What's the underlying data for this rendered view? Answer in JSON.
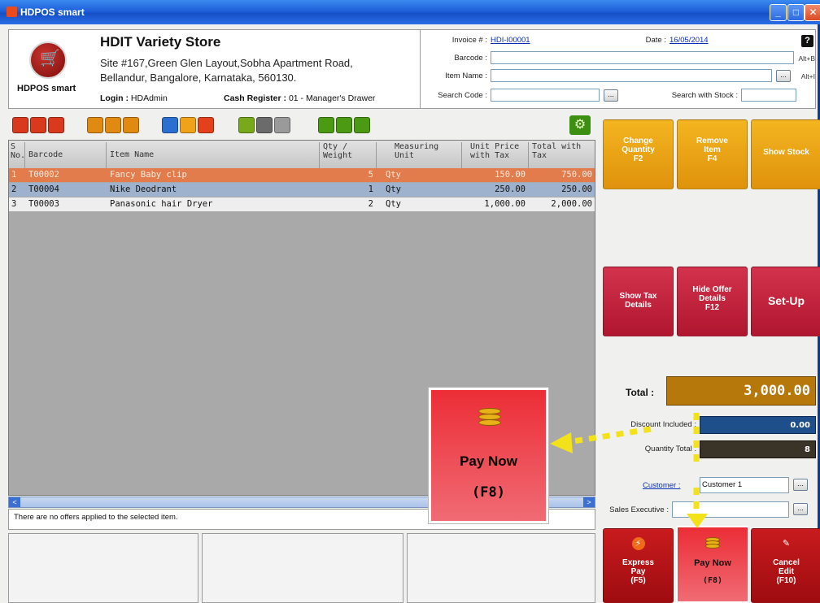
{
  "window": {
    "title": "HDPOS smart",
    "controls": {
      "minimize": "_",
      "maximize": "□",
      "close": "✕"
    }
  },
  "store": {
    "logo_text": "HDPOS smart",
    "name": "HDIT Variety Store",
    "address_line1": "Site #167,Green Glen Layout,Sobha Apartment Road,",
    "address_line2": "Bellandur, Bangalore, Karnataka, 560130.",
    "login_label": "Login :",
    "login_value": "HDAdmin",
    "register_label": "Cash Register :",
    "register_value": "01 - Manager's Drawer"
  },
  "invoice": {
    "number_label": "Invoice # :",
    "number_value": "HDI-I00001",
    "date_label": "Date :",
    "date_value": "16/05/2014",
    "help": "?",
    "barcode_label": "Barcode :",
    "barcode_hint": "Alt+B",
    "item_name_label": "Item Name :",
    "item_name_hint": "Alt+I",
    "search_code_label": "Search Code :",
    "search_stock_label": "Search with Stock :",
    "ellipsis": "..."
  },
  "toolbar": {
    "icons": [
      {
        "name": "report-icon",
        "color": "#d93a1e"
      },
      {
        "name": "open-icon",
        "color": "#d93a1e"
      },
      {
        "name": "list-icon",
        "color": "#d93a1e"
      },
      {
        "name": "edit-icon",
        "color": "#e08a12"
      },
      {
        "name": "cart-icon",
        "color": "#e08a12"
      },
      {
        "name": "user-icon",
        "color": "#e08a12"
      },
      {
        "name": "hold-icon",
        "color": "#2b6fd0"
      },
      {
        "name": "note-icon",
        "color": "#f0a21a"
      },
      {
        "name": "return-icon",
        "color": "#e2411b"
      },
      {
        "name": "calc-icon",
        "color": "#77a91a"
      },
      {
        "name": "coin-icon",
        "color": "#6b6b6b"
      },
      {
        "name": "delete-icon",
        "color": "#9a9a9a"
      },
      {
        "name": "calculator-icon",
        "color": "#4c9a14"
      },
      {
        "name": "grid-icon",
        "color": "#4c9a14"
      },
      {
        "name": "clipboard-icon",
        "color": "#4c9a14"
      }
    ],
    "settings_icon": "⚙"
  },
  "grid": {
    "columns": [
      "S No.",
      "Barcode",
      "Item Name",
      "Qty / Weight",
      "Measuring Unit",
      "Unit Price with Tax",
      "Total with Tax"
    ],
    "rows": [
      {
        "sno": "1",
        "barcode": "T00002",
        "name": "Fancy Baby clip",
        "qty": "5",
        "unit": "Qty",
        "price": "150.00",
        "total": "750.00"
      },
      {
        "sno": "2",
        "barcode": "T00004",
        "name": "Nike Deodrant",
        "qty": "1",
        "unit": "Qty",
        "price": "250.00",
        "total": "250.00"
      },
      {
        "sno": "3",
        "barcode": "T00003",
        "name": "Panasonic hair Dryer",
        "qty": "2",
        "unit": "Qty",
        "price": "1,000.00",
        "total": "2,000.00"
      }
    ],
    "scroll_left": "<",
    "scroll_right": ">"
  },
  "offers_text": "There are no offers applied to the selected item.",
  "actions": {
    "change_qty": [
      "Change",
      "Quantity",
      "F2"
    ],
    "remove_item": [
      "Remove",
      "Item",
      "F4"
    ],
    "show_stock": "Show Stock",
    "show_tax": [
      "Show Tax",
      "Details"
    ],
    "hide_offer": [
      "Hide Offer",
      "Details",
      "F12"
    ],
    "setup": "Set-Up",
    "express_pay": [
      "Express",
      "Pay",
      "(F5)"
    ],
    "pay_now": [
      "Pay Now",
      "(F8)"
    ],
    "cancel_edit": [
      "Cancel",
      "Edit",
      "(F10)"
    ]
  },
  "totals": {
    "total_label": "Total :",
    "total_value": "3,000.00",
    "discount_label": "Discount Included :",
    "discount_value": "0.00",
    "qty_label": "Quantity Total :",
    "qty_value": "8",
    "customer_label": "Customer :",
    "customer_value": "Customer 1",
    "sales_exec_label": "Sales Executive :",
    "sales_exec_value": ""
  },
  "zoom": {
    "line1": "Pay Now",
    "line2": "(F8)"
  },
  "colors": {
    "accent_orange": "#e0920c",
    "accent_red": "#b0162f",
    "total_bg": "#b6780a",
    "discount_bg": "#1f4f8a",
    "qty_bg": "#3a3328",
    "arrow": "#f3e21a"
  }
}
